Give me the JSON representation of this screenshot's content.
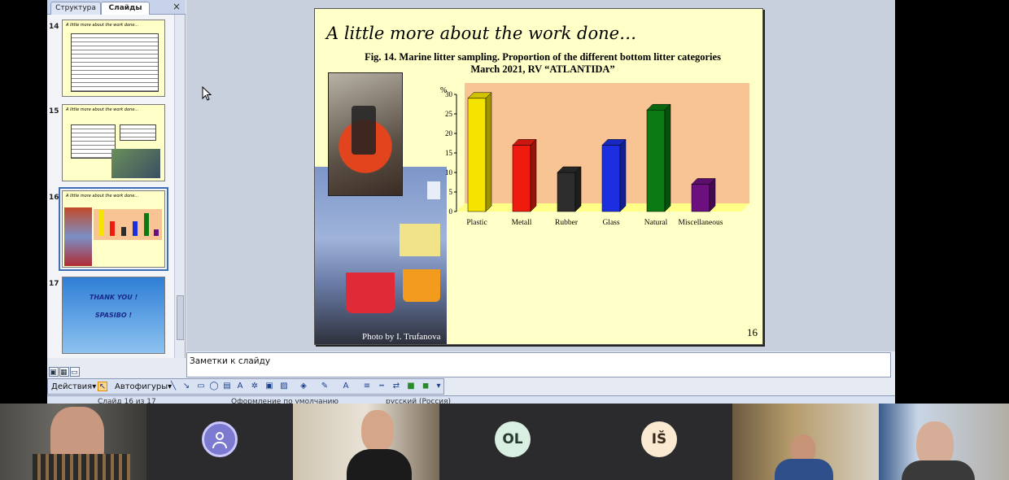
{
  "left_pane": {
    "tabs": [
      {
        "label": "Структура"
      },
      {
        "label": "Слайды"
      }
    ],
    "close_glyph": "×",
    "thumbnails": [
      {
        "number": "14",
        "title": "A little more about the work done..."
      },
      {
        "number": "15",
        "title": "A little more about the work done..."
      },
      {
        "number": "16",
        "title": "A little more about the work done..."
      },
      {
        "number": "17",
        "line1": "THANK YOU !",
        "line2": "SPASIBO !"
      }
    ]
  },
  "slide": {
    "title": "A little more about the work done…",
    "caption_line1": "Fig. 14. Marine litter sampling.  Proportion of the different bottom litter categories",
    "caption_line2": "March 2021, RV “ATLANTIDA”",
    "photo_credit": "Photo by I. Trufanova",
    "number": "16"
  },
  "chart_data": {
    "type": "bar",
    "categories": [
      "Plastic",
      "Metall",
      "Rubber",
      "Glass",
      "Natural",
      "Miscellaneous"
    ],
    "values": [
      29,
      17,
      10,
      17,
      26,
      7
    ],
    "colors": [
      "#f5e400",
      "#ef1b0f",
      "#2d2d2d",
      "#1b2fe0",
      "#0b7a12",
      "#6c1080"
    ],
    "ylabel": "%",
    "ylim": [
      0,
      30
    ],
    "yticks": [
      0,
      5,
      10,
      15,
      20,
      25,
      30
    ],
    "plot_background": "#f9c493",
    "floor_color": "#ffff88"
  },
  "notes": {
    "placeholder": "Заметки к слайду"
  },
  "drawing_toolbar": {
    "actions_label": "Действия",
    "autoshapes_label": "Автофигуры"
  },
  "status_bar": {
    "slide_info": "Слайд 16 из 17",
    "design": "Оформление по умолчанию",
    "language": "русский (Россия)"
  },
  "video_participants": [
    {
      "kind": "video"
    },
    {
      "kind": "avatar-icon"
    },
    {
      "kind": "video"
    },
    {
      "kind": "initials",
      "initials": "OL"
    },
    {
      "kind": "initials",
      "initials": "IŠ"
    },
    {
      "kind": "video"
    },
    {
      "kind": "video"
    }
  ]
}
